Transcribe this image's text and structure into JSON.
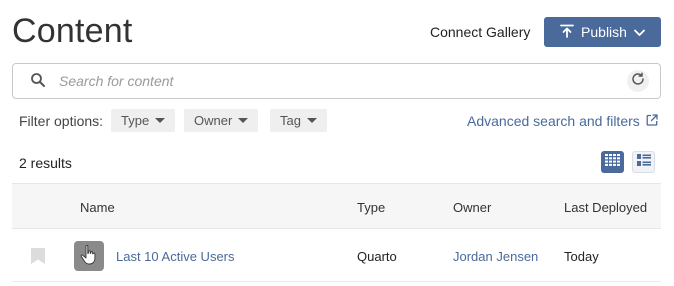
{
  "header": {
    "title": "Content",
    "connect_gallery": "Connect Gallery",
    "publish_label": "Publish"
  },
  "search": {
    "placeholder": "Search for content",
    "value": ""
  },
  "filters": {
    "label": "Filter options:",
    "type": "Type",
    "owner": "Owner",
    "tag": "Tag",
    "advanced": "Advanced search and filters"
  },
  "results": {
    "count_text": "2 results"
  },
  "table": {
    "headers": [
      "Name",
      "Type",
      "Owner",
      "Last Deployed"
    ],
    "rows": [
      {
        "name": "Last 10 Active Users",
        "type": "Quarto",
        "owner": "Jordan Jensen",
        "last_deployed": "Today"
      }
    ]
  },
  "colors": {
    "accent": "#4a6a9b",
    "link": "#4a6a9b",
    "header_bg": "#f6f6f6"
  },
  "icons": {
    "search": "search-icon",
    "refresh": "refresh-icon",
    "publish": "upload-icon",
    "external": "external-link-icon",
    "grid_view": "grid-view-icon",
    "list_view": "list-view-icon",
    "bookmark": "bookmark-icon",
    "thumbnail": "pointer-hand-icon"
  }
}
